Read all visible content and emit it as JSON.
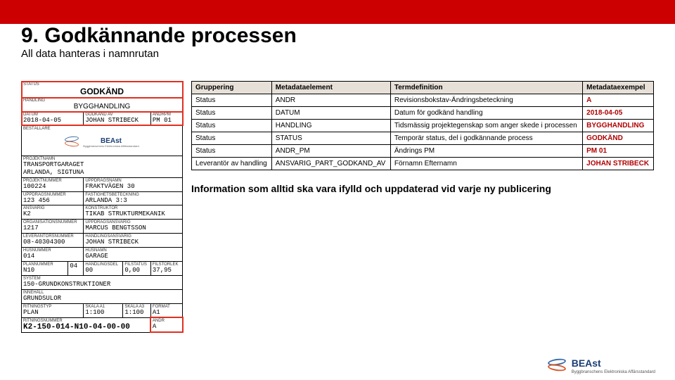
{
  "header": {
    "title": "9. Godkännande processen",
    "subtitle": "All data hanteras i namnrutan"
  },
  "drawing": {
    "status_lbl": "STATUS",
    "status": "GODKÄND",
    "handling_lbl": "HANDLING",
    "handling": "BYGGHANDLING",
    "datum_lbl": "DATUM",
    "datum": "2018-04-05",
    "godk_lbl": "GODKÄND AV",
    "godk": "JOHAN STRIBECK",
    "andr_lbl": "ÄNDRPM",
    "andr": "PM 01",
    "bestall_lbl": "BESTÄLLARE",
    "logo_name": "BEAst",
    "logo_sub": "Byggbranschens Elektroniska Affärsstandard",
    "proj_lbl": "PROJEKTNAMN",
    "proj1": "TRANSPORTGARAGET",
    "proj2": "ARLANDA, SIGTUNA",
    "pn_lbl": "PROJEKTNUMMER",
    "pn": "100224",
    "up_lbl": "UPPDRAGSNAMN",
    "up": "FRAKTVÄGEN 30",
    "un_lbl": "UPPDRAGSNUMMER",
    "un": "123 456",
    "fa_lbl": "FASTIGHETSBETECKNING",
    "fa": "ARLANDA 3:3",
    "ans_lbl": "ANSVARIG",
    "ans": "K2",
    "kons_lbl": "KONSTRUKTÖR",
    "kons": "TIKAB STRUKTURMEKANIK",
    "on_lbl": "ORGANISATIONSNUMMER",
    "on": "1217",
    "ua_lbl": "UPPDRAGSANSVARIG",
    "ua": "MARCUS BENGTSSON",
    "ln_lbl": "LEVERANTÖRSNUMMER",
    "ln": "08-40304300",
    "ha_lbl": "HANDLINGSANSVARIG",
    "ha": "JOHAN STRIBECK",
    "hus_lbl": "HUSNUMMER",
    "hus": "014",
    "husn_lbl": "HUSNAMN",
    "husn": "GARAGE",
    "plan_lbl": "PLANNUMMER",
    "plan1": "N10",
    "plan2": "04",
    "del_lbl": "HANDLINGSDEL",
    "del": "00",
    "fs_lbl": "FILSTATUS",
    "fs": "0,00",
    "fst_lbl": "FILSTORLEK",
    "fst": "37,95",
    "sys_lbl": "SYSTEM",
    "sys": "150-GRUNDKONSTRUKTIONER",
    "inne_lbl": "INNEHÅLL",
    "inne": "GRUNDSULOR",
    "rt_lbl": "RITNINGSTYP",
    "rt": "PLAN",
    "sk1_lbl": "SKALA A1",
    "sk1": "1:100",
    "sk2_lbl": "SKALA A3",
    "sk2": "1:100",
    "form_lbl": "FORMAT",
    "form": "A1",
    "rev_lbl": "ÄNDR",
    "rev": "A",
    "rn_lbl": "RITNINGSNUMMER",
    "rn": "K2-150-014-N10-04-00-00"
  },
  "meta": {
    "headers": [
      "Gruppering",
      "Metadataelement",
      "Termdefinition",
      "Metadataexempel"
    ],
    "rows": [
      {
        "g": "Status",
        "m": "ANDR",
        "t": "Revisionsbokstav-Ändringsbeteckning",
        "e": "A"
      },
      {
        "g": "Status",
        "m": "DATUM",
        "t": "Datum för godkänd handling",
        "e": "2018-04-05"
      },
      {
        "g": "Status",
        "m": "HANDLING",
        "t": "Tidsmässig projektegenskap som anger skede i processen",
        "e": "BYGGHANDLING"
      },
      {
        "g": "Status",
        "m": "STATUS",
        "t": "Temporär status, del i godkännande process",
        "e": "GODKÄND"
      },
      {
        "g": "Status",
        "m": "ANDR_PM",
        "t": "Ändrings PM",
        "e": "PM 01"
      },
      {
        "g": "Leverantör av handling",
        "m": "ANSVARIG_PART_GODKAND_AV",
        "t": "Förnamn Efternamn",
        "e": "JOHAN STRIBECK"
      }
    ],
    "info": "Information som alltid ska vara ifylld och uppdaterad vid varje ny publicering"
  },
  "footer": {
    "name": "BEAst",
    "sub": "Byggbranschens Elektroniska Affärsstandard"
  }
}
